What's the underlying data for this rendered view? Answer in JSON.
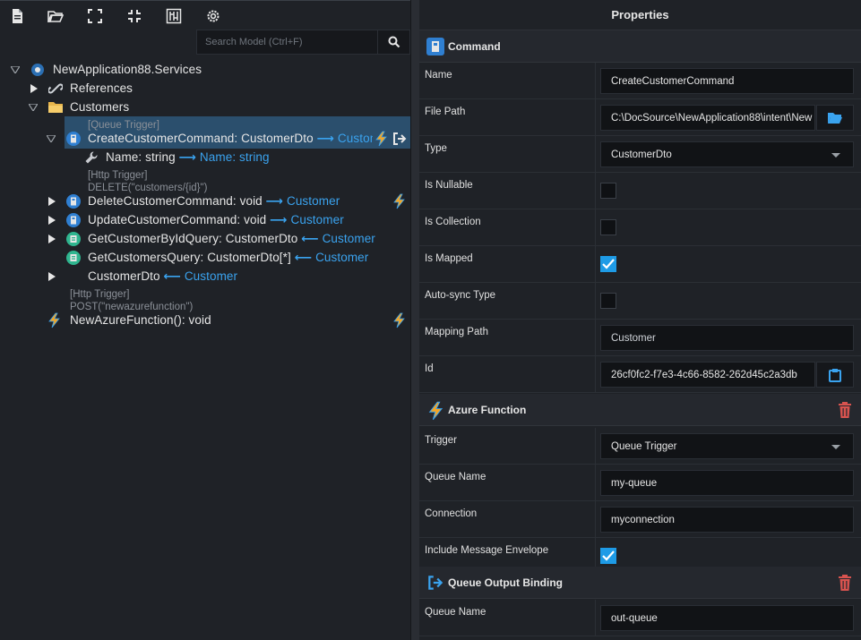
{
  "toolbar": {
    "icons": [
      "new-file-icon",
      "open-folder-icon",
      "expand-icon",
      "collapse-icon",
      "visual-editor-icon",
      "settings-icon"
    ]
  },
  "search": {
    "placeholder": "Search Model (Ctrl+F)"
  },
  "tree": {
    "root": "NewApplication88.Services",
    "references": "References",
    "customers": "Customers",
    "create": {
      "annotation": "[Queue Trigger]",
      "name": "CreateCustomerCommand: CustomerDto",
      "arrow": "⟶",
      "mapped": "Customer"
    },
    "name_attr": {
      "name": "Name: string",
      "arrow": "⟶",
      "mapped": "Name: string"
    },
    "delete": {
      "annotation1": "[Http Trigger]",
      "annotation2": "DELETE(\"customers/{id}\")",
      "name": "DeleteCustomerCommand: void",
      "arrow": "⟶",
      "mapped": "Customer"
    },
    "update": {
      "name": "UpdateCustomerCommand: void",
      "arrow": "⟶",
      "mapped": "Customer"
    },
    "getbyid": {
      "name": "GetCustomerByIdQuery: CustomerDto",
      "arrow": "⟵",
      "mapped": "Customer"
    },
    "getall": {
      "name": "GetCustomersQuery: CustomerDto[*]",
      "arrow": "⟵",
      "mapped": "Customer"
    },
    "dto": {
      "name": "CustomerDto",
      "arrow": "⟵",
      "mapped": "Customer"
    },
    "azure": {
      "annotation1": "[Http Trigger]",
      "annotation2": "POST(\"newazurefunction\")",
      "name": "NewAzureFunction(): void"
    }
  },
  "properties": {
    "title": "Properties",
    "command_section": "Command",
    "name_label": "Name",
    "name_value": "CreateCustomerCommand",
    "filepath_label": "File Path",
    "filepath_value": "C:\\DocSource\\NewApplication88\\intent\\New",
    "type_label": "Type",
    "type_value": "CustomerDto",
    "nullable_label": "Is Nullable",
    "nullable_checked": false,
    "collection_label": "Is Collection",
    "collection_checked": false,
    "mapped_label": "Is Mapped",
    "mapped_checked": true,
    "autosync_label": "Auto-sync Type",
    "autosync_checked": false,
    "mappingpath_label": "Mapping Path",
    "mappingpath_value": "Customer",
    "id_label": "Id",
    "id_value": "26cf0fc2-f7e3-4c66-8582-262d45c2a3db",
    "azure_section": "Azure Function",
    "trigger_label": "Trigger",
    "trigger_value": "Queue Trigger",
    "queuename_label": "Queue Name",
    "queuename_value": "my-queue",
    "connection_label": "Connection",
    "connection_value": "myconnection",
    "envelope_label": "Include Message Envelope",
    "envelope_checked": true,
    "output_section": "Queue Output Binding",
    "out_queuename_label": "Queue Name",
    "out_queuename_value": "out-queue"
  },
  "colors": {
    "accent": "#3aa3ef",
    "selection": "#2b4f6d",
    "checkbox_on": "#1e9be6",
    "trash": "#d9534f",
    "bolt": "#f5a623"
  }
}
